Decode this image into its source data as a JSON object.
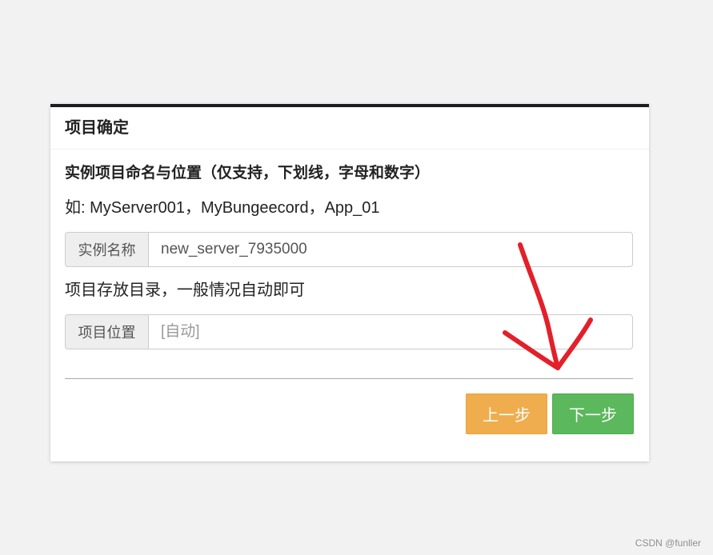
{
  "panel": {
    "title": "项目确定"
  },
  "form": {
    "heading": "实例项目命名与位置（仅支持，下划线，字母和数字）",
    "example": "如: MyServer001，MyBungeecord，App_01",
    "name_addon": "实例名称",
    "name_value": "new_server_7935000",
    "dir_hint": "项目存放目录，一般情况自动即可",
    "location_addon": "项目位置",
    "location_placeholder": "[自动]"
  },
  "buttons": {
    "prev_label": "上一步",
    "next_label": "下一步"
  },
  "annotation": {
    "type": "hand-drawn-arrow",
    "color": "#e3202a",
    "points_to": "next-button"
  },
  "colors": {
    "page_background": "#f2f2f2",
    "panel_top_border": "#1b1d21",
    "prev_button": "#f0ad4e",
    "next_button": "#5cb85c",
    "addon_background": "#eeeeee"
  },
  "watermark": "CSDN @funller"
}
